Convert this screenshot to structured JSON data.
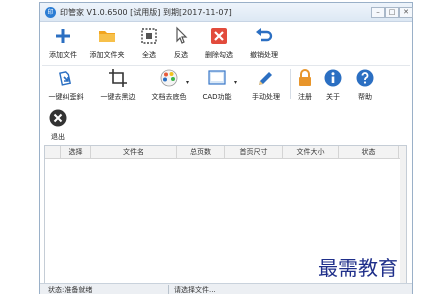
{
  "title": "印管家 V1.0.6500 [试用版] 到期[2017-11-07]",
  "app_icon": "印",
  "window_controls": {
    "minimize": "–",
    "maximize": "□",
    "close": "✕"
  },
  "toolbar_row1": [
    {
      "label": "添加文件",
      "icon": "plus-icon",
      "color": "#2b6fc2"
    },
    {
      "label": "添加文件夹",
      "icon": "folder-icon",
      "color": "#f2a51f"
    },
    {
      "label": "全选",
      "icon": "select-all-icon",
      "color": "#444444"
    },
    {
      "label": "反选",
      "icon": "cursor-icon",
      "color": "#555555"
    },
    {
      "label": "删除勾选",
      "icon": "delete-icon",
      "color": "#e24b3c"
    },
    {
      "label": "撤销处理",
      "icon": "undo-icon",
      "color": "#2b6fc2"
    }
  ],
  "toolbar_row2": [
    {
      "label": "一键纠歪斜",
      "icon": "deskew-icon",
      "color": "#2b6fc2"
    },
    {
      "label": "一键去黑边",
      "icon": "crop-icon",
      "color": "#333333"
    },
    {
      "label": "文档去底色",
      "icon": "palette-icon",
      "color": "#e85b3a"
    },
    {
      "label": "CAD功能",
      "icon": "cad-icon",
      "color": "#3a78c9"
    },
    {
      "label": "手动处理",
      "icon": "pencil-icon",
      "color": "#2b6fc2"
    },
    {
      "label": "注册",
      "icon": "lock-icon",
      "color": "#e8952a"
    },
    {
      "label": "关于",
      "icon": "info-icon",
      "color": "#2b6fc2"
    },
    {
      "label": "帮助",
      "icon": "help-icon",
      "color": "#2b6fc2"
    }
  ],
  "toolbar_row3": [
    {
      "label": "退出",
      "icon": "exit-icon",
      "color": "#333333"
    }
  ],
  "table": {
    "columns": [
      "",
      "选择",
      "文件名",
      "总页数",
      "首页尺寸",
      "文件大小",
      "状态"
    ]
  },
  "status": {
    "left": "状态:准备就绪",
    "right": "请选择文件..."
  },
  "watermark": "最需教育"
}
